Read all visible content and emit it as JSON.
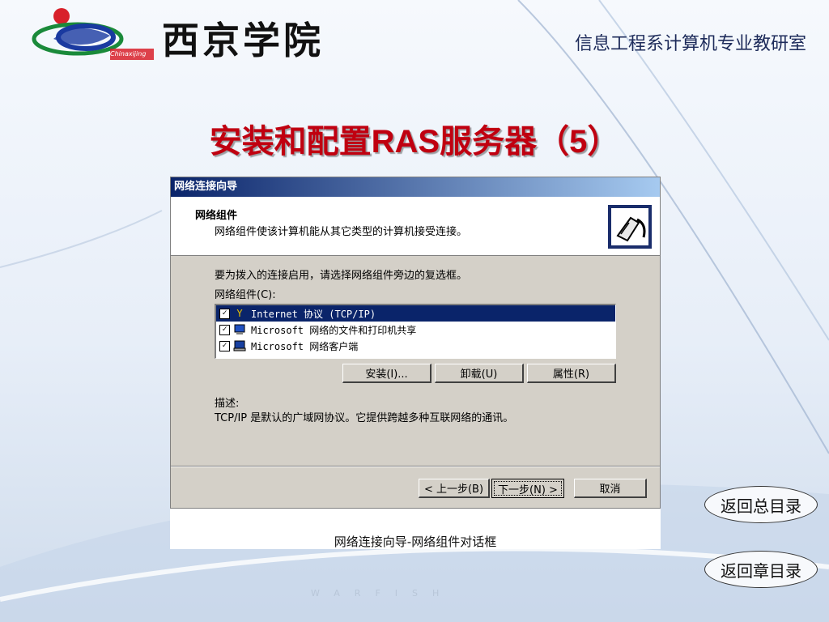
{
  "header": {
    "school_name": "西京学院",
    "logo_text": "Chinaxijing",
    "department": "信息工程系计算机专业教研室"
  },
  "slide": {
    "title": "安装和配置RAS服务器（5）"
  },
  "dialog": {
    "window_title": "网络连接向导",
    "header_title": "网络组件",
    "header_subtitle": "网络组件使该计算机能从其它类型的计算机接受连接。",
    "prompt": "要为拨入的连接启用，请选择网络组件旁边的复选框。",
    "list_label": "网络组件(C):",
    "components": [
      {
        "checked": true,
        "selected": true,
        "icon": "protocol-icon",
        "label": "Internet 协议 (TCP/IP)"
      },
      {
        "checked": true,
        "selected": false,
        "icon": "file-share-icon",
        "label": "Microsoft 网络的文件和打印机共享"
      },
      {
        "checked": true,
        "selected": false,
        "icon": "network-client-icon",
        "label": "Microsoft 网络客户端"
      }
    ],
    "install_label": "安装(I)...",
    "uninstall_label": "卸载(U)",
    "properties_label": "属性(R)",
    "description_label": "描述:",
    "description_text": "TCP/IP 是默认的广域网协议。它提供跨越多种互联网络的通讯。",
    "back_label": "< 上一步(B)",
    "next_label": "下一步(N) >",
    "cancel_label": "取消"
  },
  "caption": "网络连接向导-网络组件对话框",
  "nav": {
    "main_menu_label": "返回总目录",
    "chapter_menu_label": "返回章目录"
  },
  "watermark": "WARFISH",
  "colors": {
    "title_red": "#c00010",
    "dialog_titlebar": "#0a246a",
    "dialog_face": "#d4d0c8"
  }
}
